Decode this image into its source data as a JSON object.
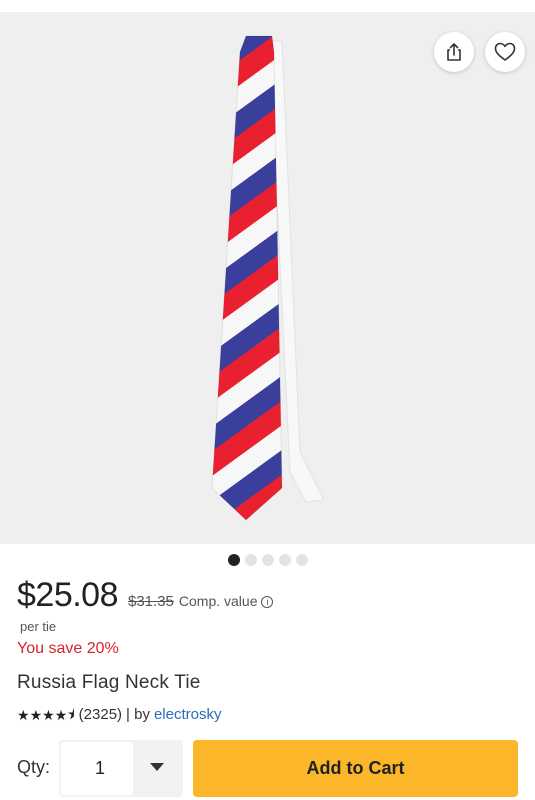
{
  "product": {
    "title": "Russia Flag Neck Tie",
    "price": "$25.08",
    "original_price": "$31.35",
    "comp_label": "Comp. value",
    "per_unit": "per tie",
    "savings": "You save 20%",
    "rating": 4.5,
    "rating_count": "(2325)",
    "by_label": "| by",
    "seller": "electrosky",
    "image_count": 5,
    "active_image": 1
  },
  "cart": {
    "qty_label": "Qty:",
    "qty_value": "1",
    "add_label": "Add to Cart"
  },
  "colors": {
    "red": "#e8202f",
    "blue": "#3a3f9c",
    "white": "#f7f7f7",
    "accent": "#fbb62a",
    "sale": "#d8232a",
    "link": "#2a6fb5"
  },
  "icons": {
    "share": "share-icon",
    "wishlist": "heart-icon",
    "info": "info-icon",
    "dropdown": "chevron-down-icon"
  }
}
